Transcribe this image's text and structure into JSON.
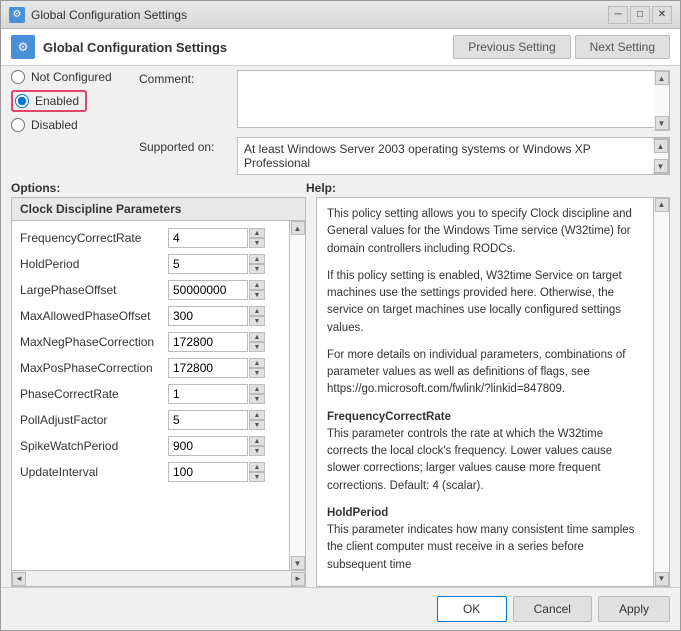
{
  "window": {
    "title": "Global Configuration Settings",
    "header_title": "Global Configuration Settings"
  },
  "titlebar": {
    "minimize": "─",
    "maximize": "□",
    "close": "✕"
  },
  "nav_buttons": {
    "previous": "Previous Setting",
    "next": "Next Setting"
  },
  "radio": {
    "not_configured": "Not Configured",
    "enabled": "Enabled",
    "disabled": "Disabled"
  },
  "comment": {
    "label": "Comment:",
    "value": ""
  },
  "supported": {
    "label": "Supported on:",
    "value": "At least Windows Server 2003 operating systems or Windows XP Professional"
  },
  "options": {
    "title": "Options:",
    "section_header": "Clock Discipline Parameters",
    "items": [
      {
        "name": "FrequencyCorrectRate",
        "value": "4"
      },
      {
        "name": "HoldPeriod",
        "value": "5"
      },
      {
        "name": "LargePhaseOffset",
        "value": "50000000"
      },
      {
        "name": "MaxAllowedPhaseOffset",
        "value": "300"
      },
      {
        "name": "MaxNegPhaseCorrection",
        "value": "172800"
      },
      {
        "name": "MaxPosPhaseCorrection",
        "value": "172800"
      },
      {
        "name": "PhaseCorrectRate",
        "value": "1"
      },
      {
        "name": "PollAdjustFactor",
        "value": "5"
      },
      {
        "name": "SpikeWatchPeriod",
        "value": "900"
      },
      {
        "name": "UpdateInterval",
        "value": "100"
      }
    ]
  },
  "help": {
    "title": "Help:",
    "paragraphs": [
      "This policy setting allows you to specify Clock discipline and General values for the Windows Time service (W32time) for domain controllers including RODCs.",
      "If this policy setting is enabled, W32time Service on target machines use the settings provided here. Otherwise, the service on target machines use locally configured settings values.",
      "For more details on individual parameters, combinations of parameter values as well as definitions of flags, see https://go.microsoft.com/fwlink/?linkid=847809.",
      "FrequencyCorrectRate\nThis parameter controls the rate at which the W32time corrects the local clock's frequency. Lower values cause slower corrections; larger values cause more frequent corrections. Default: 4 (scalar).",
      "HoldPeriod\nThis parameter indicates how many consistent time samples the client computer must receive in a series before subsequent time"
    ]
  },
  "footer": {
    "ok": "OK",
    "cancel": "Cancel",
    "apply": "Apply"
  }
}
